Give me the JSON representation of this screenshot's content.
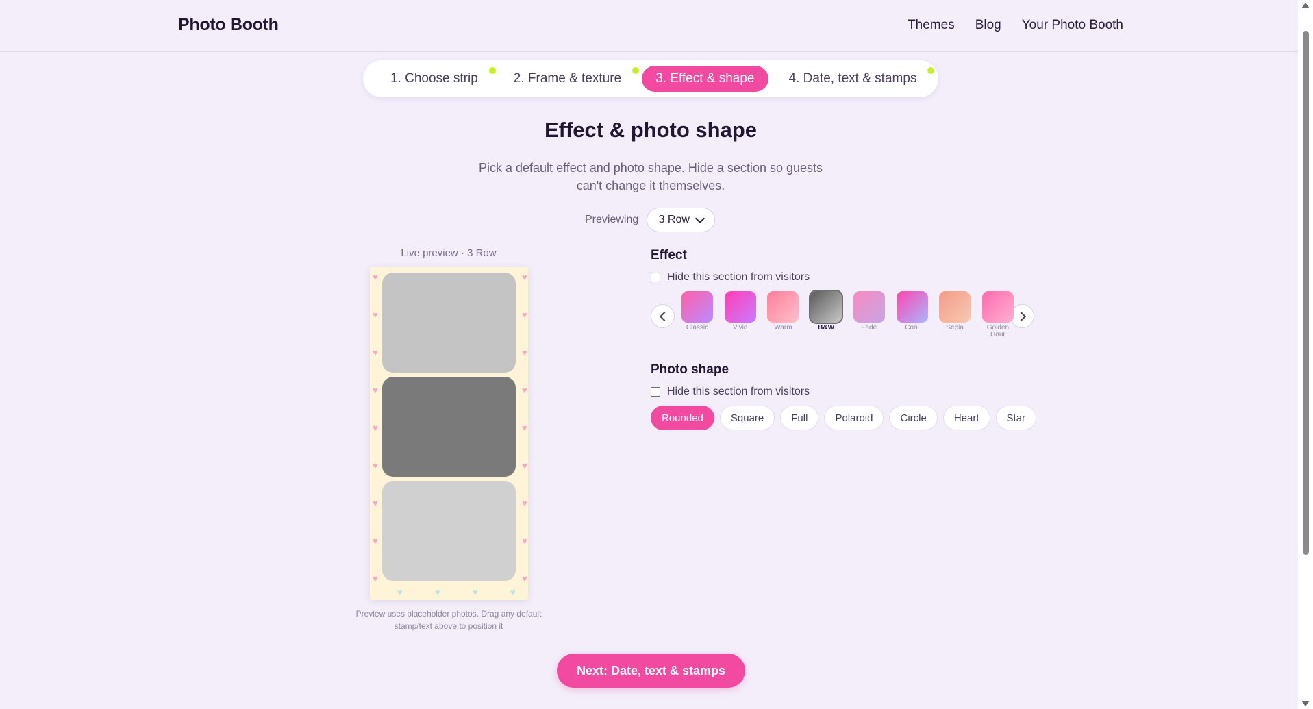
{
  "brand": "Photo Booth",
  "nav": [
    "Themes",
    "Blog",
    "Your Photo Booth"
  ],
  "steps": [
    {
      "label": "1. Choose strip",
      "done": true
    },
    {
      "label": "2. Frame & texture",
      "done": true
    },
    {
      "label": "3. Effect & shape",
      "active": true
    },
    {
      "label": "4. Date, text & stamps",
      "done": true
    }
  ],
  "page": {
    "title": "Effect & photo shape",
    "subtitle": "Pick a default effect and photo shape. Hide a section so guests can't change it themselves."
  },
  "previewing": {
    "label": "Previewing",
    "value": "3 Row"
  },
  "preview": {
    "label": "Live preview · 3 Row",
    "note": "Preview uses placeholder photos. Drag any default stamp/text above to position it",
    "photos": [
      "#c4c4c4",
      "#7a7a7a",
      "#d0d0d0"
    ],
    "strip_bg": "#fff4d8"
  },
  "effect": {
    "heading": "Effect",
    "hide_label": "Hide this section from visitors",
    "hidden": false,
    "selected": "B&W",
    "items": [
      {
        "name": "Classic",
        "from": "#ff5fa8",
        "to": "#b98cff"
      },
      {
        "name": "Vivid",
        "from": "#ff3fb4",
        "to": "#c97bff"
      },
      {
        "name": "Warm",
        "from": "#ff7e9e",
        "to": "#ffc0c8"
      },
      {
        "name": "B&W",
        "from": "#5a5a5a",
        "to": "#c8c8c8"
      },
      {
        "name": "Fade",
        "from": "#f98ac0",
        "to": "#c7a5e6"
      },
      {
        "name": "Cool",
        "from": "#ff45b0",
        "to": "#a9b6ff"
      },
      {
        "name": "Sepia",
        "from": "#f59b8a",
        "to": "#f6c9b1"
      },
      {
        "name": "Golden Hour",
        "from": "#ff6ab0",
        "to": "#ffb0d0"
      }
    ]
  },
  "shape": {
    "heading": "Photo shape",
    "hide_label": "Hide this section from visitors",
    "hidden": false,
    "selected": "Rounded",
    "items": [
      "Rounded",
      "Square",
      "Full",
      "Polaroid",
      "Circle",
      "Heart",
      "Star"
    ]
  },
  "cta": "Next: Date, text & stamps",
  "colors": {
    "accent": "#f24aa0",
    "done_dot": "#c5ef2a"
  }
}
